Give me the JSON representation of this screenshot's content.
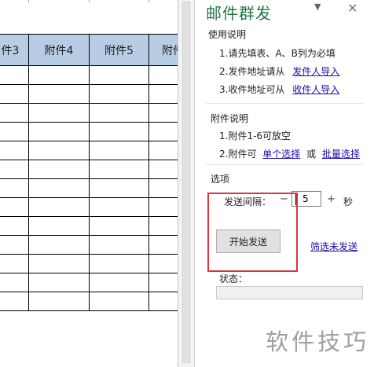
{
  "sheet": {
    "headers": [
      "件3",
      "附件4",
      "附件5",
      "附件"
    ],
    "row_count": 13
  },
  "pane": {
    "title": "邮件群发",
    "menu_icon": "triangle-down",
    "close_icon": "x",
    "usage": {
      "title": "使用说明",
      "line1": "1.请先填表、A、B列为必填",
      "line2_prefix": "2.发件地址请从",
      "line2_link": "发件人导入",
      "line3_prefix": "3.收件地址可从",
      "line3_link": "收件人导入"
    },
    "attachments": {
      "title": "附件说明",
      "line1": "1.附件1-6可放空",
      "line2_prefix": "2.附件可",
      "single_link": "单个选择",
      "or": "或",
      "batch_link": "批量选择"
    },
    "options": {
      "title": "选项",
      "interval_label": "发送间隔：",
      "minus": "−",
      "interval_value": "5",
      "plus": "+",
      "unit": "秒"
    },
    "start_button": "开始发送",
    "filter_link": "筛选未发送",
    "status_label": "状态：",
    "status_progress": 0
  },
  "watermark": "软件技巧"
}
